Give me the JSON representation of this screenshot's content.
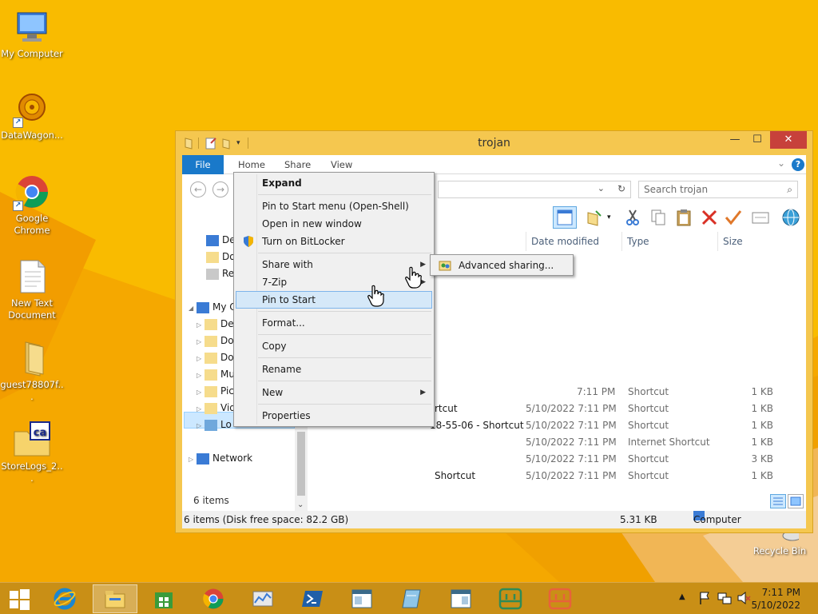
{
  "desktop": {
    "icons": [
      {
        "label": "My Computer"
      },
      {
        "label": "DataWagon..."
      },
      {
        "label": "Google Chrome"
      },
      {
        "label": "New Text Document"
      },
      {
        "label": "guest78807f..."
      },
      {
        "label": "StoreLogs_2..."
      },
      {
        "label": "Recycle Bin"
      }
    ]
  },
  "window": {
    "title": "trojan",
    "tabs": {
      "file": "File",
      "home": "Home",
      "share": "Share",
      "view": "View"
    },
    "search_placeholder": "Search trojan",
    "columns": {
      "date": "Date modified",
      "type": "Type",
      "size": "Size"
    },
    "nav": [
      {
        "label": "De"
      },
      {
        "label": "Do"
      },
      {
        "label": "Re"
      },
      {
        "label": "My C"
      },
      {
        "label": "De"
      },
      {
        "label": "Do"
      },
      {
        "label": "Do"
      },
      {
        "label": "Mu"
      },
      {
        "label": "Pic"
      },
      {
        "label": "Vid"
      },
      {
        "label": "Lo"
      },
      {
        "label": "Network"
      }
    ],
    "rows": [
      {
        "name": "",
        "date": "7:11 PM",
        "type": "Shortcut",
        "size": "1 KB"
      },
      {
        "name": "rtcut",
        "date": "5/10/2022 7:11 PM",
        "type": "Shortcut",
        "size": "1 KB"
      },
      {
        "name": "18-55-06 - Shortcut",
        "date": "5/10/2022 7:11 PM",
        "type": "Shortcut",
        "size": "1 KB"
      },
      {
        "name": "",
        "date": "5/10/2022 7:11 PM",
        "type": "Internet Shortcut",
        "size": "1 KB"
      },
      {
        "name": "",
        "date": "5/10/2022 7:11 PM",
        "type": "Shortcut",
        "size": "3 KB"
      },
      {
        "name": "Shortcut",
        "date": "5/10/2022 7:11 PM",
        "type": "Shortcut",
        "size": "1 KB"
      }
    ],
    "items_count": "6 items",
    "status": {
      "left": "6 items (Disk free space: 82.2 GB)",
      "size": "5.31 KB",
      "location": "Computer"
    }
  },
  "context_menu": {
    "items": [
      {
        "label": "Expand"
      },
      {
        "label": "Pin to Start menu (Open-Shell)"
      },
      {
        "label": "Open in new window"
      },
      {
        "label": "Turn on BitLocker"
      },
      {
        "label": "Share with"
      },
      {
        "label": "7-Zip"
      },
      {
        "label": "Pin to Start"
      },
      {
        "label": "Format..."
      },
      {
        "label": "Copy"
      },
      {
        "label": "Rename"
      },
      {
        "label": "New"
      },
      {
        "label": "Properties"
      }
    ],
    "submenu": {
      "label": "Advanced sharing..."
    }
  },
  "taskbar": {
    "time": "7:11 PM",
    "date": "5/10/2022"
  },
  "colors": {
    "desktop": "#f7b500",
    "window_frame": "#f5c74f",
    "file_tab": "#1979ca",
    "close_button": "#c7413b",
    "menu_highlight": "#d5e8f8"
  }
}
